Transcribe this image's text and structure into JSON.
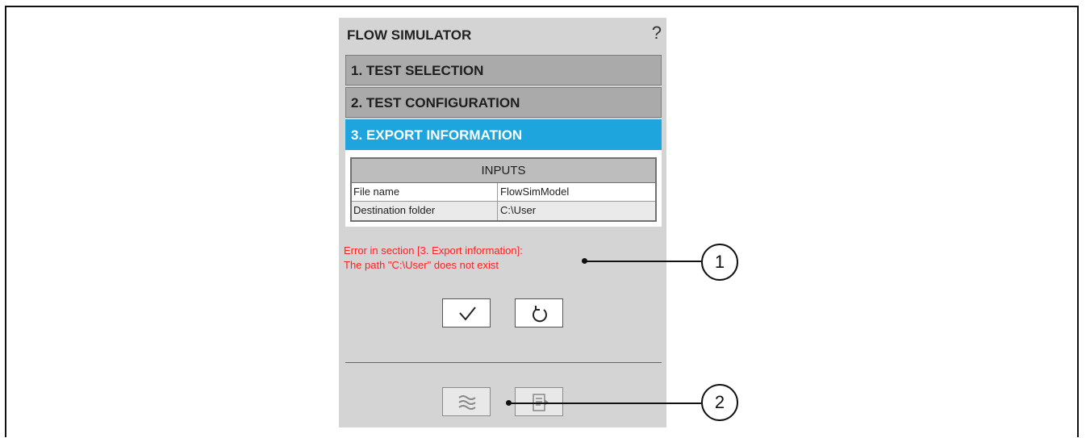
{
  "panel": {
    "title": "FLOW SIMULATOR",
    "help_icon": "?"
  },
  "sections": [
    {
      "label": "1. TEST SELECTION",
      "active": false
    },
    {
      "label": "2. TEST CONFIGURATION",
      "active": false
    },
    {
      "label": "3. EXPORT INFORMATION",
      "active": true
    }
  ],
  "inputs": {
    "header": "INPUTS",
    "rows": [
      {
        "field": "File name",
        "value": "FlowSimModel"
      },
      {
        "field": "Destination folder",
        "value": "C:\\User"
      }
    ]
  },
  "error": {
    "line1": "Error in section [3. Export information]:",
    "line2": "The path \"C:\\User\" does not exist"
  },
  "buttons": {
    "confirm_icon": "checkmark-icon",
    "reset_icon": "rotate-icon",
    "flow_icon": "waves-icon",
    "export_icon": "export-document-icon"
  },
  "callouts": [
    "1",
    "2"
  ],
  "colors": {
    "panel_bg": "#d4d4d4",
    "section_bg": "#aaaaaa",
    "active_section": "#1ea5dd",
    "error_text": "#ff2020"
  }
}
